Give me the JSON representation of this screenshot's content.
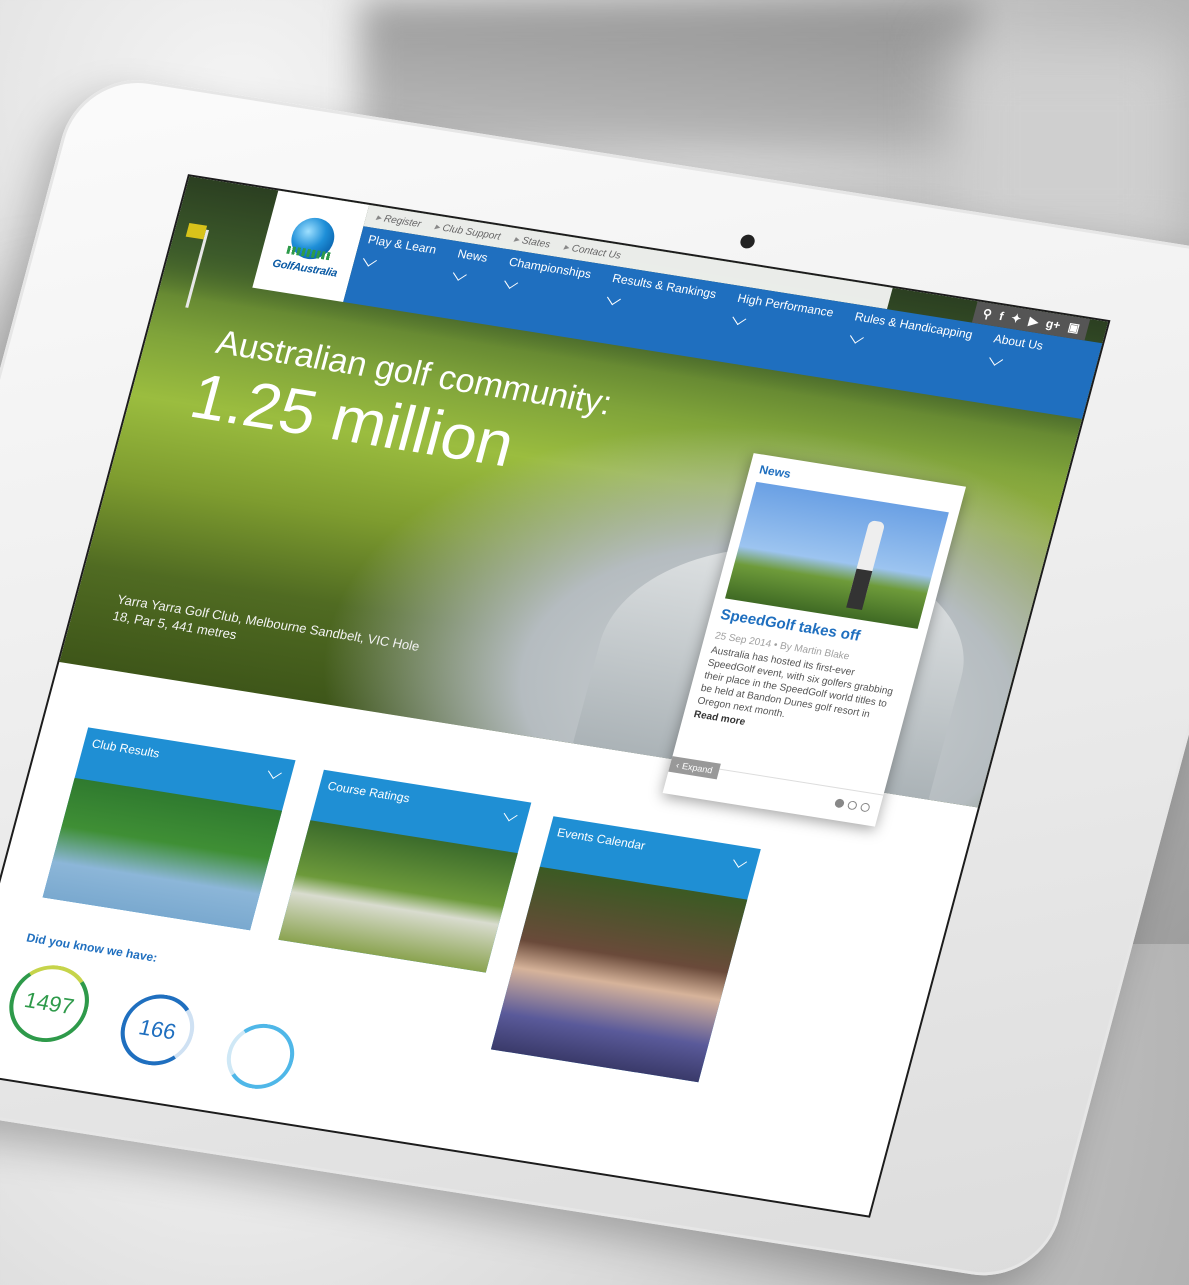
{
  "utility_links": [
    "Register",
    "Club Support",
    "States",
    "Contact Us"
  ],
  "logo": {
    "text": "GolfAustralia"
  },
  "nav_items": [
    "Play & Learn",
    "News",
    "Championships",
    "Results & Rankings",
    "High Performance",
    "Rules & Handicapping",
    "About Us"
  ],
  "social_icons": [
    "search-icon",
    "facebook-icon",
    "twitter-icon",
    "youtube-icon",
    "google-plus-icon",
    "instagram-icon"
  ],
  "hero": {
    "title": "Australian golf community:",
    "value": "1.25 million",
    "caption": "Yarra Yarra Golf Club, Melbourne Sandbelt, VIC Hole 18, Par 5, 441 metres"
  },
  "news_card": {
    "label": "News",
    "headline": "SpeedGolf takes off",
    "meta": "25 Sep 2014 • By Martin Blake",
    "excerpt": "Australia has hosted its first-ever SpeedGolf event, with six golfers grabbing their place in the SpeedGolf world titles to be held at Bandon Dunes golf resort in Oregon next month.",
    "read_more": "Read more",
    "expand": "Expand"
  },
  "tiles": [
    "Club Results",
    "Course Ratings",
    "Events Calendar"
  ],
  "stats": {
    "title": "Did you know we have:",
    "values": [
      "1497",
      "166",
      ""
    ]
  },
  "colors": {
    "brand_blue": "#1f6fbf",
    "tile_blue": "#1f8fd4",
    "green": "#2e9a4a"
  }
}
